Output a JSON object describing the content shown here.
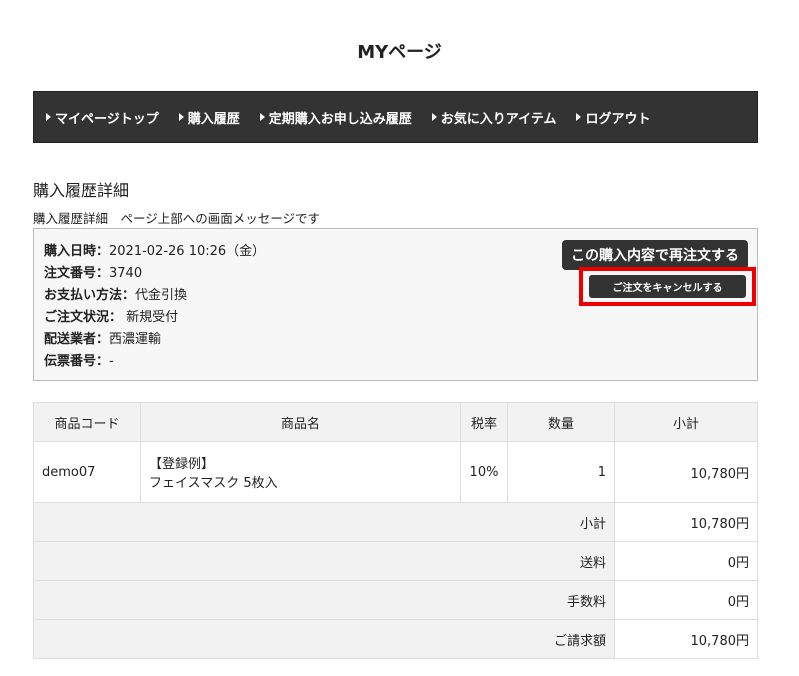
{
  "page_title": "MYページ",
  "nav": [
    "マイページトップ",
    "購入履歴",
    "定期購入お申し込み履歴",
    "お気に入りアイテム",
    "ログアウト"
  ],
  "section_title": "購入履歴詳細",
  "message": "購入履歴詳細　ページ上部への画面メッセージです",
  "info": [
    {
      "label": "購入日時：",
      "value": "2021-02-26 10:26（金）"
    },
    {
      "label": "注文番号：",
      "value": "3740"
    },
    {
      "label": "お支払い方法：",
      "value": "代金引換"
    },
    {
      "label": "ご注文状況：",
      "value": " 新規受付"
    },
    {
      "label": "配送業者：",
      "value": "西濃運輸"
    },
    {
      "label": "伝票番号：",
      "value": "-"
    }
  ],
  "buttons": {
    "reorder": "この購入内容で再注文する",
    "cancel": "ご注文をキャンセルする"
  },
  "table": {
    "headers": [
      "商品コード",
      "商品名",
      "税率",
      "数量",
      "小計"
    ],
    "item": {
      "code": "demo07",
      "name1": "【登録例】",
      "name2": "フェイスマスク 5枚入",
      "tax": "10%",
      "qty": "1",
      "subtotal": "10,780円"
    },
    "totals": [
      {
        "label": "小計",
        "value": "10,780円"
      },
      {
        "label": "送料",
        "value": "0円"
      },
      {
        "label": "手数料",
        "value": "0円"
      },
      {
        "label": "ご請求額",
        "value": "10,780円"
      }
    ]
  },
  "colors": {
    "highlight": "#e00000",
    "dark": "#333333"
  }
}
